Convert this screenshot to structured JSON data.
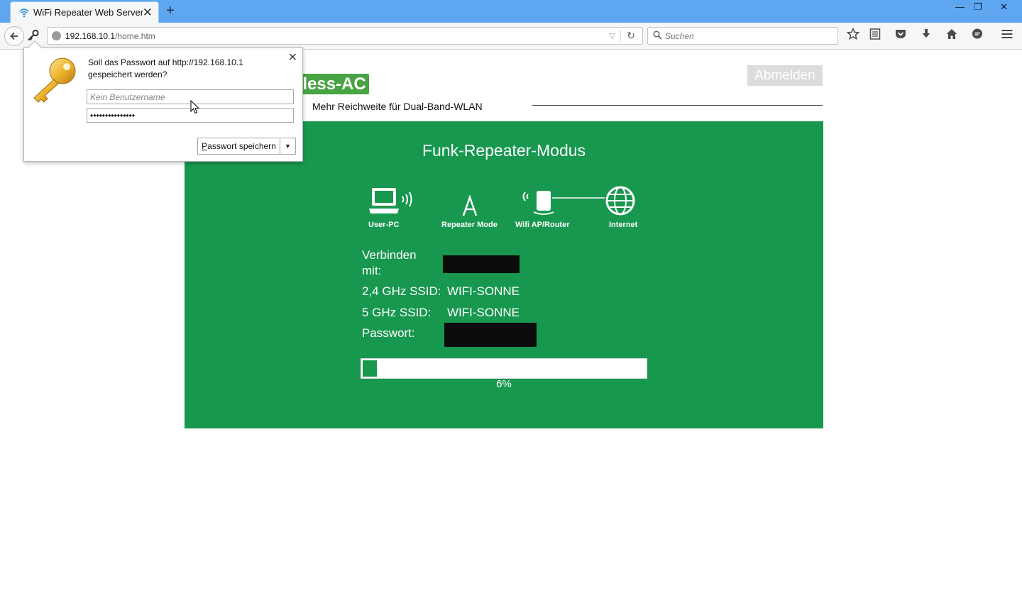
{
  "browser": {
    "tab_title": "WiFi Repeater Web Server",
    "tab_close": "✕",
    "new_tab": "+",
    "window_minimize": "—",
    "window_restore": "❐",
    "window_close": "✕",
    "url_host": "192.168.10.1",
    "url_path": "/home.htm",
    "search_placeholder": "Suchen",
    "toolbar_icons": [
      "star-icon",
      "reading-list-icon",
      "pocket-icon",
      "download-icon",
      "home-icon",
      "chat-icon",
      "menu-icon"
    ]
  },
  "password_popup": {
    "message": "Soll das Passwort auf http://192.168.10.1 gespeichert werden?",
    "username_placeholder": "Kein Benutzername",
    "password_value": "•••••••••••••••",
    "save_button_accesskey": "P",
    "save_button_rest": "asswort speichern",
    "dropdown": "▼"
  },
  "page": {
    "brand_fragment": "eless-AC",
    "tagline": "Mehr Reichweite für Dual-Band-WLAN",
    "logout": "Abmelden",
    "title": "Funk-Repeater-Modus",
    "diagram": {
      "user_pc": "User-PC",
      "repeater_mode": "Repeater Mode",
      "wifi_ap_router": "Wifi AP/Router",
      "internet": "Internet"
    },
    "connect_label_1": "Verbinden",
    "connect_label_2": "mit:",
    "ssid24_label": "2,4 GHz SSID:",
    "ssid24_value": "WIFI-SONNE",
    "ssid5_label": "5 GHz SSID:",
    "ssid5_value": "WIFI-SONNE",
    "password_label": "Passwort:",
    "progress_percent": 6,
    "progress_text": "6%"
  },
  "colors": {
    "panel_green": "#18974f",
    "brand_green": "#48a342",
    "titlebar_blue": "#5ea7f0"
  }
}
